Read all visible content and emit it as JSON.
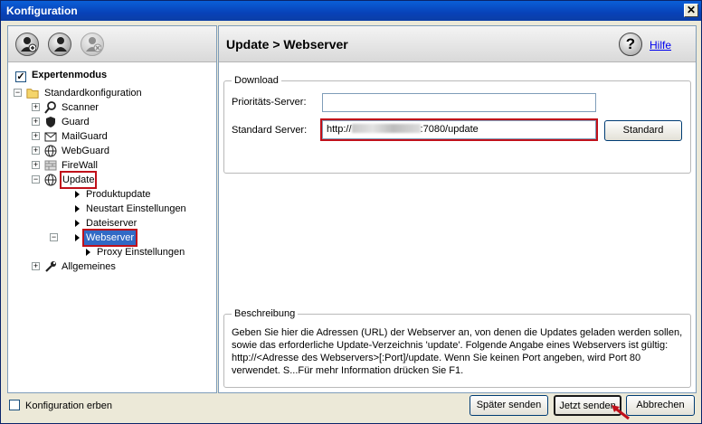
{
  "window": {
    "title": "Konfiguration",
    "close_glyph": "✕"
  },
  "left": {
    "expert_label": "Expertenmodus",
    "expert_checked": true,
    "tree": {
      "root": "Standardkonfiguration",
      "scanner": "Scanner",
      "guard": "Guard",
      "mailguard": "MailGuard",
      "webguard": "WebGuard",
      "firewall": "FireWall",
      "update": "Update",
      "produktupdate": "Produktupdate",
      "neustart": "Neustart Einstellungen",
      "dateiserver": "Dateiserver",
      "webserver": "Webserver",
      "proxy": "Proxy Einstellungen",
      "allgemeines": "Allgemeines"
    }
  },
  "right": {
    "title": "Update > Webserver",
    "help_glyph": "?",
    "help_link": "Hilfe",
    "download_legend": "Download",
    "priority_label": "Prioritäts-Server:",
    "priority_value": "",
    "standard_label": "Standard Server:",
    "standard_prefix": "http://",
    "standard_suffix": ":7080/update",
    "standard_button": "Standard",
    "description_legend": "Beschreibung",
    "description_text": "Geben Sie hier die Adressen (URL) der Webserver an, von denen die Updates geladen werden sollen, sowie das erforderliche Update-Verzeichnis 'update'. Folgende Angabe eines Webservers ist gültig: http://<Adresse des Webservers>[:Port]/update. Wenn Sie keinen Port angeben, wird Port 80 verwendet. S...Für mehr Information drücken Sie F1."
  },
  "bottom": {
    "inherit_label": "Konfiguration erben",
    "inherit_checked": false,
    "later_button": "Später senden",
    "now_button": "Jetzt senden",
    "cancel_button": "Abbrechen"
  },
  "colors": {
    "title_bar": "#0842b8",
    "selection": "#316ac5",
    "highlight_outline": "#c0101a",
    "link": "#0000ee"
  }
}
